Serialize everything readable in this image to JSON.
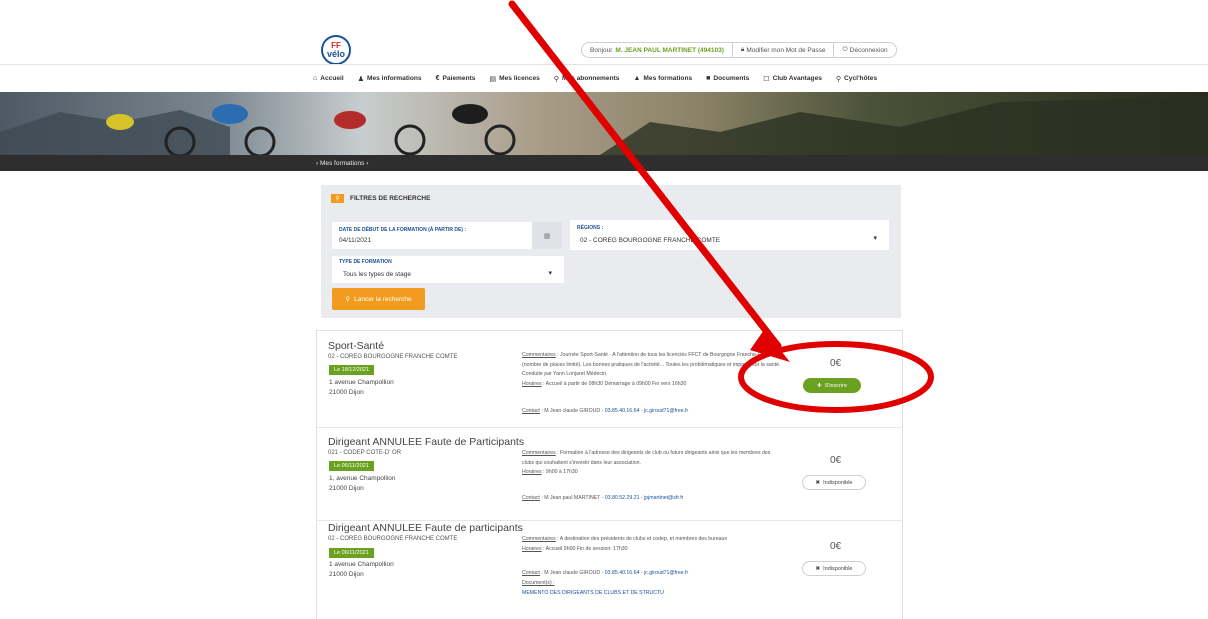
{
  "header": {
    "logo_ff": "FF",
    "logo_velo": "vélo",
    "greeting": "Bonjour",
    "user_name": "M. JEAN PAUL MARTINET (494103)",
    "change_password": "Modifier mon Mot de Passe",
    "logout": "Déconnexion"
  },
  "nav": {
    "items": [
      {
        "icon": "home-icon",
        "glyph": "⌂",
        "label": "Accueil"
      },
      {
        "icon": "user-icon",
        "glyph": "♟",
        "label": "Mes informations"
      },
      {
        "icon": "euro-icon",
        "glyph": "€",
        "label": "Paiements"
      },
      {
        "icon": "card-icon",
        "glyph": "▤",
        "label": "Mes licences"
      },
      {
        "icon": "bike-icon",
        "glyph": "⚲",
        "label": "Mes abonnements"
      },
      {
        "icon": "graduation-icon",
        "glyph": "▲",
        "label": "Mes formations"
      },
      {
        "icon": "folder-icon",
        "glyph": "■",
        "label": "Documents"
      },
      {
        "icon": "club-icon",
        "glyph": "☐",
        "label": "Club Avantages"
      },
      {
        "icon": "search-icon",
        "glyph": "⚲",
        "label": "Cycl'hôtes"
      }
    ]
  },
  "breadcrumb": {
    "text": "›  Mes formations  ›"
  },
  "filters": {
    "title": "FILTRES DE RECHERCHE",
    "date_label": "DATE DE DÉBUT DE LA FORMATION (À PARTIR DE) :",
    "date_value": "04/11/2021",
    "region_label": "RÉGIONS :",
    "region_value": "02 - COREG BOURGOGNE FRANCHE COMTE",
    "type_label": "TYPE DE FORMATION",
    "type_value": "Tous les types de stage",
    "search_button": "Lancer la recherche"
  },
  "results": [
    {
      "title": "Sport-Santé",
      "region": "02 - COREG BOURGOGNE FRANCHE COMTE",
      "date": "Le 18/12/2021",
      "address1": "1 avenue Champollion",
      "address2": "21000 Dijon",
      "comment_label": "Commentaires",
      "comment": " : Journée Sport-Santé - A l'attention de tous les licenciés FFCT de Bourgogne Franche-Comté (nombre de places limité). Les bonnes pratiques de l'activité... Toutes les problématiques et impacts sur la santé. Conduite par Yann Lonjaret Médecin.",
      "hours_label": "Horaires",
      "hours": " : Accueil à partir de 08h30 Démarrage à 09h00 Fin vers 16h30",
      "contact_label": "Contact",
      "contact_name": " : M Jean claude GIROUD - ",
      "contact_phone": "03.85.40.16.64",
      "contact_email": "jc.giroud71@free.fr",
      "price": "0€",
      "action": "S'inscrire",
      "action_available": true
    },
    {
      "title": "Dirigeant ANNULEE Faute de Participants",
      "region": "021 - CODEP COTE-D' OR",
      "date": "Le 06/11/2021",
      "address1": "1, avenue Champollion",
      "address2": "21000 Dijon",
      "comment_label": "Commentaires",
      "comment": " : Formation à l'adresse des dirigeants de club ou futurs dirigeants ainsi que les membres des clubs qui souhaitent s'investir dans leur association.",
      "hours_label": "Horaires",
      "hours": " : 9h00 à 17h30",
      "contact_label": "Contact",
      "contact_name": " : M Jean paul MARTINET - ",
      "contact_phone": "03.80.52.29.21",
      "contact_email": "jpjmartinet@sfr.fr",
      "price": "0€",
      "action": "Indisponible",
      "action_available": false
    },
    {
      "title": "Dirigeant ANNULEE Faute de participants",
      "region": "02 - COREG BOURGOGNE FRANCHE COMTE",
      "date": "Le 06/11/2021",
      "address1": "1 avenue Champollion",
      "address2": "21000 Dijon",
      "comment_label": "Commentaires",
      "comment": " : A destination des présidents de clubs et codep, et membres des bureaux",
      "hours_label": "Horaires",
      "hours": " : Accueil 9h00 Fin de session: 17h30",
      "contact_label": "Contact",
      "contact_name": " : M Jean claude GIROUD - ",
      "contact_phone": "03.85.40.16.64",
      "contact_email": "jc.giroud71@free.fr",
      "documents_label": "Document(s) :",
      "document_link": "MEMENTO DES DIRIGEANTS DE CLUBS ET DE STRUCTU",
      "price": "0€",
      "action": "Indisponible",
      "action_available": false
    }
  ],
  "colors": {
    "accent_green": "#6aa121",
    "accent_orange": "#f29c1f",
    "brand_blue": "#1a4f9a",
    "annotation_red": "#e00000"
  }
}
